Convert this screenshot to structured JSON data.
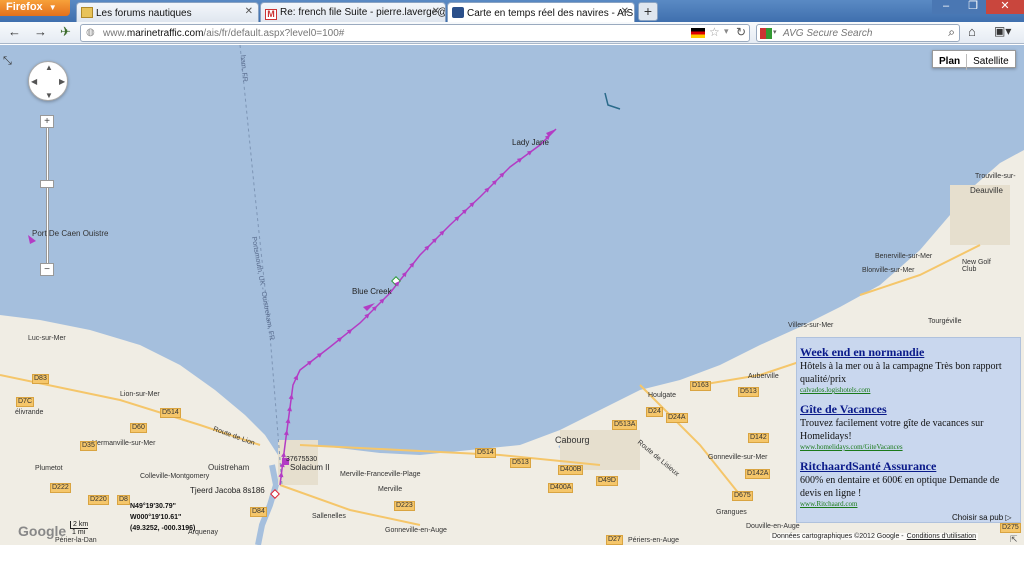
{
  "browser": {
    "firefox_label": "Firefox",
    "tabs": [
      {
        "label": "Les forums nautiques",
        "icon": "folder-icon"
      },
      {
        "label": "Re: french file Suite - pierre.laverge@...",
        "icon": "gmail-icon"
      },
      {
        "label": "Carte en temps réel des navires - AIS ...",
        "icon": "ship-icon"
      }
    ],
    "new_tab": "+",
    "url_prefix": "www.",
    "url_domain": "marinetraffic.com",
    "url_rest": "/ais/fr/default.aspx?level0=100#",
    "search_placeholder": "AVG Secure Search"
  },
  "map": {
    "type_buttons": [
      "Plan",
      "Satellite"
    ],
    "places": {
      "port": "Port De Caen Ouistre",
      "luc": "Luc-sur-Mer",
      "lion": "Lion-sur-Mer",
      "hermanville": "Hermanville-sur-Mer",
      "colleville": "Colleville-Montgomery",
      "plumetot": "Plumetot",
      "delivrande": "élivrande",
      "ouistreham": "Ouistreham",
      "merville_plage": "Merville-Franceville-Plage",
      "merville": "Merville",
      "sallenelles": "Sallenelles",
      "gonneville_auge": "Gonneville-en-Auge",
      "cabourg": "Cabourg",
      "houlgate": "Houlgate",
      "auberville": "Auberville",
      "gonneville_mer": "Gonneville-sur-Mer",
      "grangues": "Grangues",
      "douville": "Douville-en-Auge",
      "villers": "Villers-sur-Mer",
      "blonville": "Blonville-sur-Mer",
      "benerville": "Benerville-sur-Mer",
      "deauville": "Deauville",
      "trouville": "Trouville-sur-",
      "tourgeville": "Tourgéville",
      "newgolf": "New Golf Club",
      "perier": "Périers-en-Auge",
      "arquenay": "Arquenay",
      "perier_dan": "Périer-la-Dan",
      "route_lion": "Route de Lion",
      "route_lisieux": "Route de Lisieux",
      "ferry": "Portsmouth, UK - Ouistreham, FR",
      "ferry2": "ham, FR"
    },
    "roads": [
      "D83",
      "D7C",
      "D514",
      "D35",
      "D60",
      "D222",
      "D220",
      "D8",
      "D84",
      "D514",
      "D513",
      "D400B",
      "D400A",
      "D49D",
      "D163",
      "D513",
      "D513A",
      "D24",
      "D24A",
      "D142",
      "D142A",
      "D675",
      "D27",
      "D275",
      "D223"
    ],
    "ships": {
      "lady_jane": "Lady Jane",
      "blue_creek": "Blue Creek",
      "solacium": "Solacium II",
      "tjeerd": "Tjeerd Jacoba 8s186",
      "id": "37675530"
    },
    "coords": {
      "lat": "N49°19'30.79\"",
      "lon": "W000°19'10.61\"",
      "dec": "(49.3252, -000.3196)"
    },
    "scale": {
      "km": "2 km",
      "mi": "1 mi"
    },
    "google": "Google",
    "footer_data": "Données cartographiques ©2012 Google -",
    "footer_link": "Conditions d'utilisation"
  },
  "ad": {
    "items": [
      {
        "title": "Week end en normandie",
        "body": "Hôtels à la mer ou à la campagne Très bon rapport qualité/prix",
        "url": "calvados.logishotels.com"
      },
      {
        "title": "Gîte de Vacances",
        "body": "Trouvez facilement votre gîte de vacances sur Homelidays!",
        "url": "www.homelidays.com/GiteVacances"
      },
      {
        "title": "RitchaardSanté Assurance",
        "body": "600% en dentaire et 600€ en optique Demande de devis en ligne !",
        "url": "www.Ritchaard.com"
      }
    ],
    "choice": "Choisir sa pub"
  },
  "colors": {
    "sea": "#a5bfdd",
    "land": "#f0ede4",
    "track": "#b33cc4",
    "ad_bg": "#c9d7ee"
  }
}
